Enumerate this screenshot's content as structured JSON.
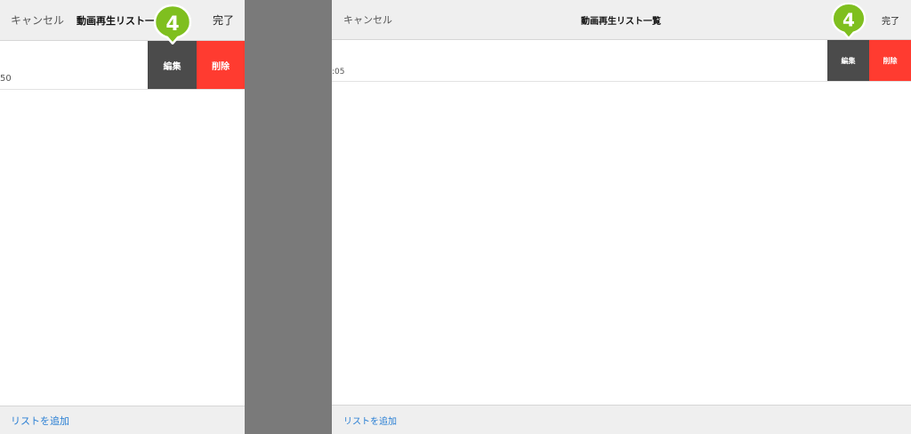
{
  "colors": {
    "navbar_bg": "#efefef",
    "edit_button": "#4b4b4b",
    "delete_button": "#ff3b30",
    "footer_link": "#2a7fd4",
    "callout_badge": "#7fbf1f",
    "separator_bg": "#7a7a7a"
  },
  "left_panel": {
    "cancel_label": "キャンセル",
    "title": "動画再生リスト一",
    "done_label": "完了",
    "row_text": "50",
    "edit_label": "編集",
    "delete_label": "削除",
    "footer_link": "リストを追加",
    "callout_number": "4"
  },
  "right_panel": {
    "cancel_label": "キャンセル",
    "title": "動画再生リスト一覧",
    "done_label": "完了",
    "row_text": ":05",
    "edit_label": "編集",
    "delete_label": "削除",
    "footer_link": "リストを追加",
    "callout_number": "4"
  }
}
